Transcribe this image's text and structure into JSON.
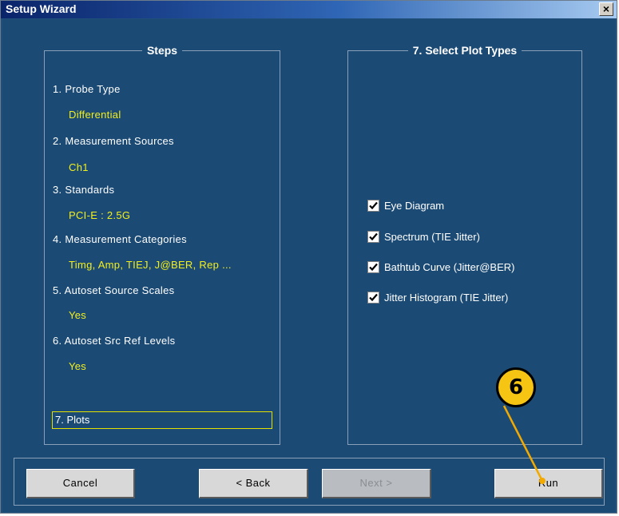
{
  "window": {
    "title": "Setup Wizard",
    "close_glyph": "×"
  },
  "steps": {
    "title": "Steps",
    "items": [
      {
        "label": "1. Probe Type",
        "value": "Differential"
      },
      {
        "label": "2. Measurement Sources",
        "value": "Ch1"
      },
      {
        "label": "3. Standards",
        "value": "PCI-E : 2.5G"
      },
      {
        "label": "4. Measurement Categories",
        "value": "Timg, Amp, TIEJ, J@BER, Rep ..."
      },
      {
        "label": "5. Autoset Source Scales",
        "value": "Yes"
      },
      {
        "label": "6. Autoset Src Ref Levels",
        "value": "Yes"
      }
    ],
    "current": "7. Plots"
  },
  "plots": {
    "title": "7. Select Plot Types",
    "options": [
      {
        "label": "Eye Diagram",
        "checked": true
      },
      {
        "label": "Spectrum (TIE Jitter)",
        "checked": true
      },
      {
        "label": "Bathtub Curve (Jitter@BER)",
        "checked": true
      },
      {
        "label": "Jitter Histogram (TIE Jitter)",
        "checked": true
      }
    ]
  },
  "buttons": {
    "cancel": "Cancel",
    "back": "< Back",
    "next": "Next >",
    "run": "Run"
  },
  "callout": {
    "number": "6"
  },
  "colors": {
    "background": "#1b4a74",
    "value_text": "#f2ef1e",
    "callout_fill": "#f6c513",
    "accent_line": "#f2a900"
  }
}
